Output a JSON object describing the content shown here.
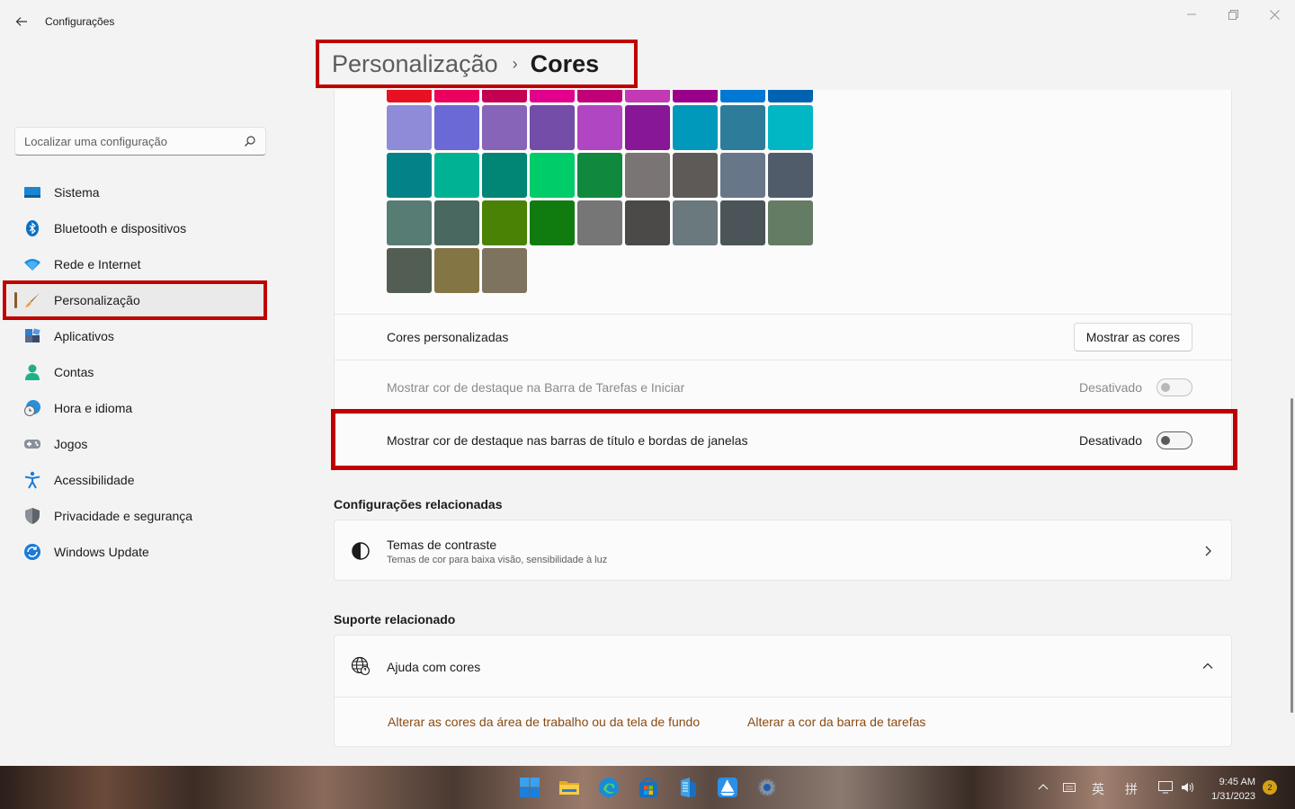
{
  "app": {
    "title": "Configurações"
  },
  "breadcrumb": {
    "parent": "Personalização",
    "separator": "›",
    "current": "Cores"
  },
  "search": {
    "placeholder": "Localizar uma configuração"
  },
  "nav": {
    "items": [
      {
        "label": "Sistema",
        "icon": "monitor-icon"
      },
      {
        "label": "Bluetooth e dispositivos",
        "icon": "bluetooth-icon"
      },
      {
        "label": "Rede e Internet",
        "icon": "wifi-icon"
      },
      {
        "label": "Personalização",
        "icon": "paintbrush-icon",
        "active": true
      },
      {
        "label": "Aplicativos",
        "icon": "apps-icon"
      },
      {
        "label": "Contas",
        "icon": "person-icon"
      },
      {
        "label": "Hora e idioma",
        "icon": "globe-clock-icon"
      },
      {
        "label": "Jogos",
        "icon": "gamepad-icon"
      },
      {
        "label": "Acessibilidade",
        "icon": "accessibility-icon"
      },
      {
        "label": "Privacidade e segurança",
        "icon": "shield-icon"
      },
      {
        "label": "Windows Update",
        "icon": "update-icon"
      }
    ]
  },
  "palette": {
    "rows": [
      [
        "#e81123",
        "#ea005e",
        "#c30052",
        "#e3008c",
        "#bf0077",
        "#c239b3",
        "#9a0089",
        "#0078d4",
        "#0063b1"
      ],
      [
        "#8e8cd8",
        "#6b69d6",
        "#8764b8",
        "#744da9",
        "#b146c2",
        "#881798",
        "#0099bc",
        "#2d7d9a",
        "#00b7c3"
      ],
      [
        "#038387",
        "#00b294",
        "#018574",
        "#00cc6a",
        "#10893e",
        "#7a7574",
        "#5d5a58",
        "#68768a",
        "#515c6b"
      ],
      [
        "#567c73",
        "#486860",
        "#498205",
        "#107c10",
        "#767676",
        "#4c4a48",
        "#69797e",
        "#4a5459",
        "#647c64"
      ],
      [
        "#525e54",
        "#847545",
        "#7e735f"
      ]
    ]
  },
  "custom_colors": {
    "label": "Cores personalizadas",
    "button": "Mostrar as cores"
  },
  "taskbar_accent": {
    "label": "Mostrar cor de destaque na Barra de Tarefas e Iniciar",
    "state": "Desativado"
  },
  "titlebar_accent": {
    "label": "Mostrar cor de destaque nas barras de título e bordas de janelas",
    "state": "Desativado"
  },
  "related_settings": {
    "title": "Configurações relacionadas",
    "contrast": {
      "title": "Temas de contraste",
      "subtitle": "Temas de cor para baixa visão, sensibilidade à luz",
      "icon": "contrast-icon"
    }
  },
  "related_support": {
    "title": "Suporte relacionado",
    "help": {
      "title": "Ajuda com cores",
      "icon": "globe-help-icon"
    },
    "links": [
      "Alterar as cores da área de trabalho ou da tela de fundo",
      "Alterar a cor da barra de tarefas"
    ]
  },
  "taskbar": {
    "tray": [
      "英",
      "拼"
    ],
    "time": "9:45 AM",
    "date": "1/31/2023",
    "notifications": "2"
  },
  "colors": {
    "highlight": "#c00000",
    "accent": "#8a4a12"
  }
}
